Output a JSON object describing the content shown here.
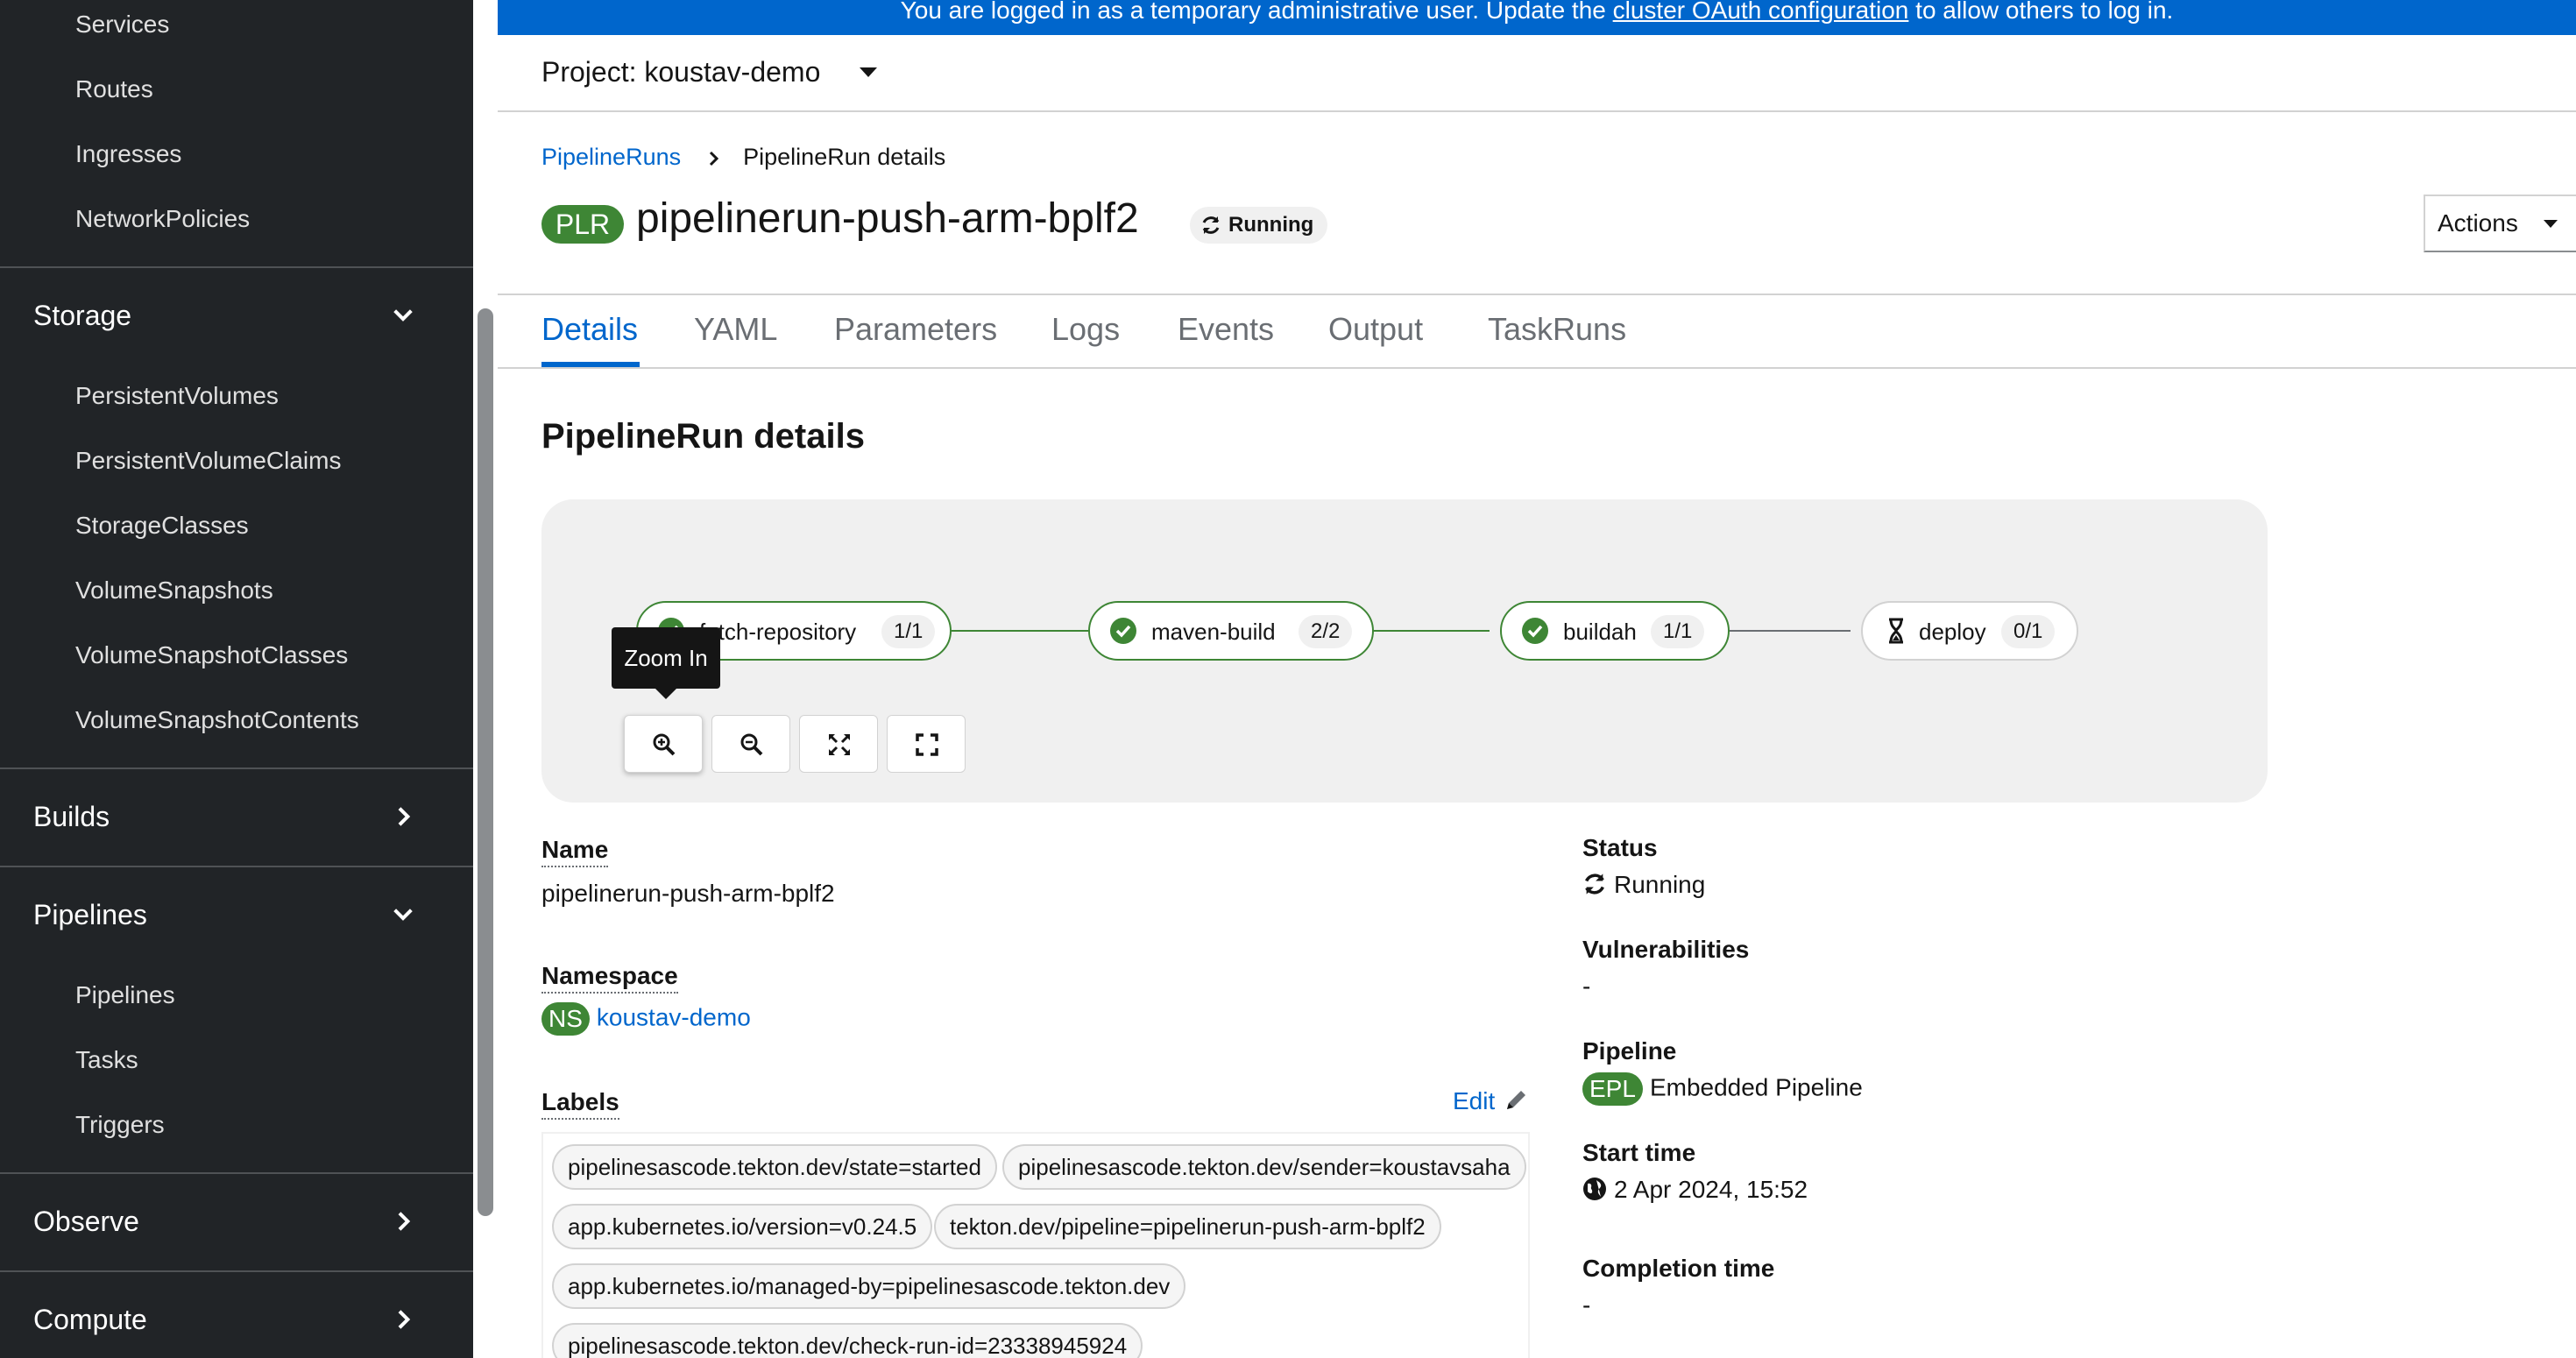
{
  "sidebar": {
    "network_items": [
      "Services",
      "Routes",
      "Ingresses",
      "NetworkPolicies"
    ],
    "sections": [
      {
        "label": "Storage",
        "expanded": true,
        "items": [
          "PersistentVolumes",
          "PersistentVolumeClaims",
          "StorageClasses",
          "VolumeSnapshots",
          "VolumeSnapshotClasses",
          "VolumeSnapshotContents"
        ]
      },
      {
        "label": "Builds",
        "expanded": false,
        "items": []
      },
      {
        "label": "Pipelines",
        "expanded": true,
        "items": [
          "Pipelines",
          "Tasks",
          "Triggers"
        ]
      },
      {
        "label": "Observe",
        "expanded": false,
        "items": []
      },
      {
        "label": "Compute",
        "expanded": false,
        "items": []
      }
    ]
  },
  "banner": {
    "prefix": "You are logged in as a temporary administrative user. Update the ",
    "link": "cluster OAuth configuration",
    "suffix": " to allow others to log in."
  },
  "project": {
    "label": "Project: koustav-demo"
  },
  "breadcrumb": {
    "parent": "PipelineRuns",
    "current": "PipelineRun details"
  },
  "header": {
    "badge": "PLR",
    "title": "pipelinerun-push-arm-bplf2",
    "status": "Running",
    "actions_label": "Actions"
  },
  "tabs": [
    "Details",
    "YAML",
    "Parameters",
    "Logs",
    "Events",
    "Output",
    "TaskRuns"
  ],
  "active_tab": "Details",
  "section_title": "PipelineRun details",
  "pipeline_graph": {
    "tasks": [
      {
        "name": "fetch-repository",
        "count": "1/1",
        "state": "succeeded"
      },
      {
        "name": "maven-build",
        "count": "2/2",
        "state": "succeeded"
      },
      {
        "name": "buildah",
        "count": "1/1",
        "state": "succeeded"
      },
      {
        "name": "deploy",
        "count": "0/1",
        "state": "pending"
      }
    ],
    "tooltip": "Zoom In",
    "controls": [
      "zoom-in",
      "zoom-out",
      "fit-to-screen",
      "reset-view"
    ]
  },
  "details": {
    "name_label": "Name",
    "name_value": "pipelinerun-push-arm-bplf2",
    "namespace_label": "Namespace",
    "namespace_badge": "NS",
    "namespace_value": "koustav-demo",
    "labels_label": "Labels",
    "edit_label": "Edit",
    "labels": [
      "pipelinesascode.tekton.dev/state=started",
      "pipelinesascode.tekton.dev/sender=koustavsaha",
      "app.kubernetes.io/version=v0.24.5",
      "tekton.dev/pipeline=pipelinerun-push-arm-bplf2",
      "app.kubernetes.io/managed-by=pipelinesascode.tekton.dev",
      "pipelinesascode.tekton.dev/check-run-id=23338945924"
    ],
    "status_label": "Status",
    "status_value": "Running",
    "vulnerabilities_label": "Vulnerabilities",
    "vulnerabilities_value": "-",
    "pipeline_label": "Pipeline",
    "pipeline_badge": "EPL",
    "pipeline_value": "Embedded Pipeline",
    "start_time_label": "Start time",
    "start_time_value": "2 Apr 2024, 15:52",
    "completion_time_label": "Completion time",
    "completion_time_value": "-"
  },
  "colors": {
    "sidebar_bg": "#212427",
    "accent": "#0066cc",
    "success": "#3e8635",
    "graph_bg": "#f0f0f0"
  }
}
